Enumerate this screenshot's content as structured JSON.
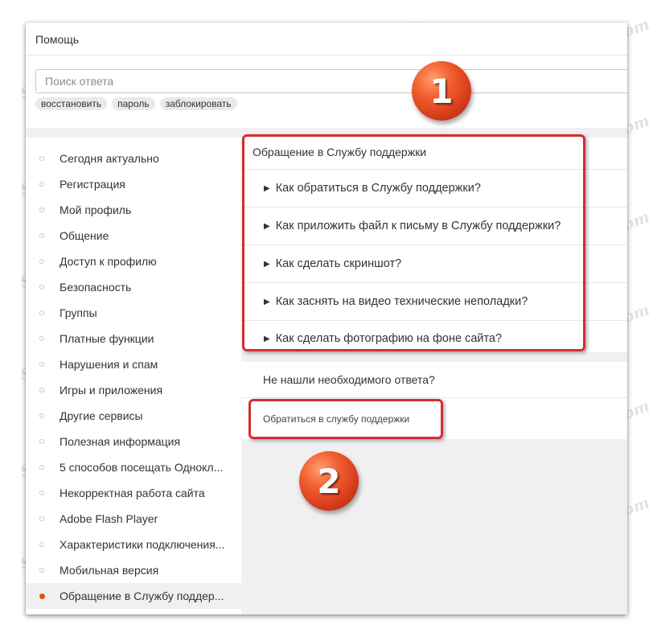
{
  "header": {
    "title": "Помощь"
  },
  "search": {
    "placeholder": "Поиск ответа",
    "value": ""
  },
  "tags": [
    "восстановить",
    "пароль",
    "заблокировать"
  ],
  "sidebar": {
    "items": [
      {
        "label": "Сегодня актуально"
      },
      {
        "label": "Регистрация"
      },
      {
        "label": "Мой профиль"
      },
      {
        "label": "Общение"
      },
      {
        "label": "Доступ к профилю"
      },
      {
        "label": "Безопасность"
      },
      {
        "label": "Группы"
      },
      {
        "label": "Платные функции"
      },
      {
        "label": "Нарушения и спам"
      },
      {
        "label": "Игры и приложения"
      },
      {
        "label": "Другие сервисы"
      },
      {
        "label": "Полезная информация"
      },
      {
        "label": "5 способов посещать Однокл..."
      },
      {
        "label": "Некорректная работа сайта"
      },
      {
        "label": "Adobe Flash Player"
      },
      {
        "label": "Характеристики подключения..."
      },
      {
        "label": "Мобильная версия"
      },
      {
        "label": "Обращение в Службу поддер...",
        "active": true
      }
    ]
  },
  "faq": {
    "title": "Обращение в Службу поддержки",
    "items": [
      "Как обратиться в Службу поддержки?",
      "Как приложить файл к письму в Службу поддержки?",
      "Как сделать скриншот?",
      "Как заснять на видео технические неполадки?",
      "Как сделать фотографию на фоне сайта?"
    ]
  },
  "help": {
    "question": "Не нашли необходимого ответа?",
    "link": "Обратиться в службу поддержки"
  },
  "badges": [
    "1",
    "2"
  ],
  "watermark": "Soringpcrepair.Com",
  "colors": {
    "accent": "#ee4f0b",
    "highlight": "#d62b35",
    "badge": "#e8471c"
  }
}
